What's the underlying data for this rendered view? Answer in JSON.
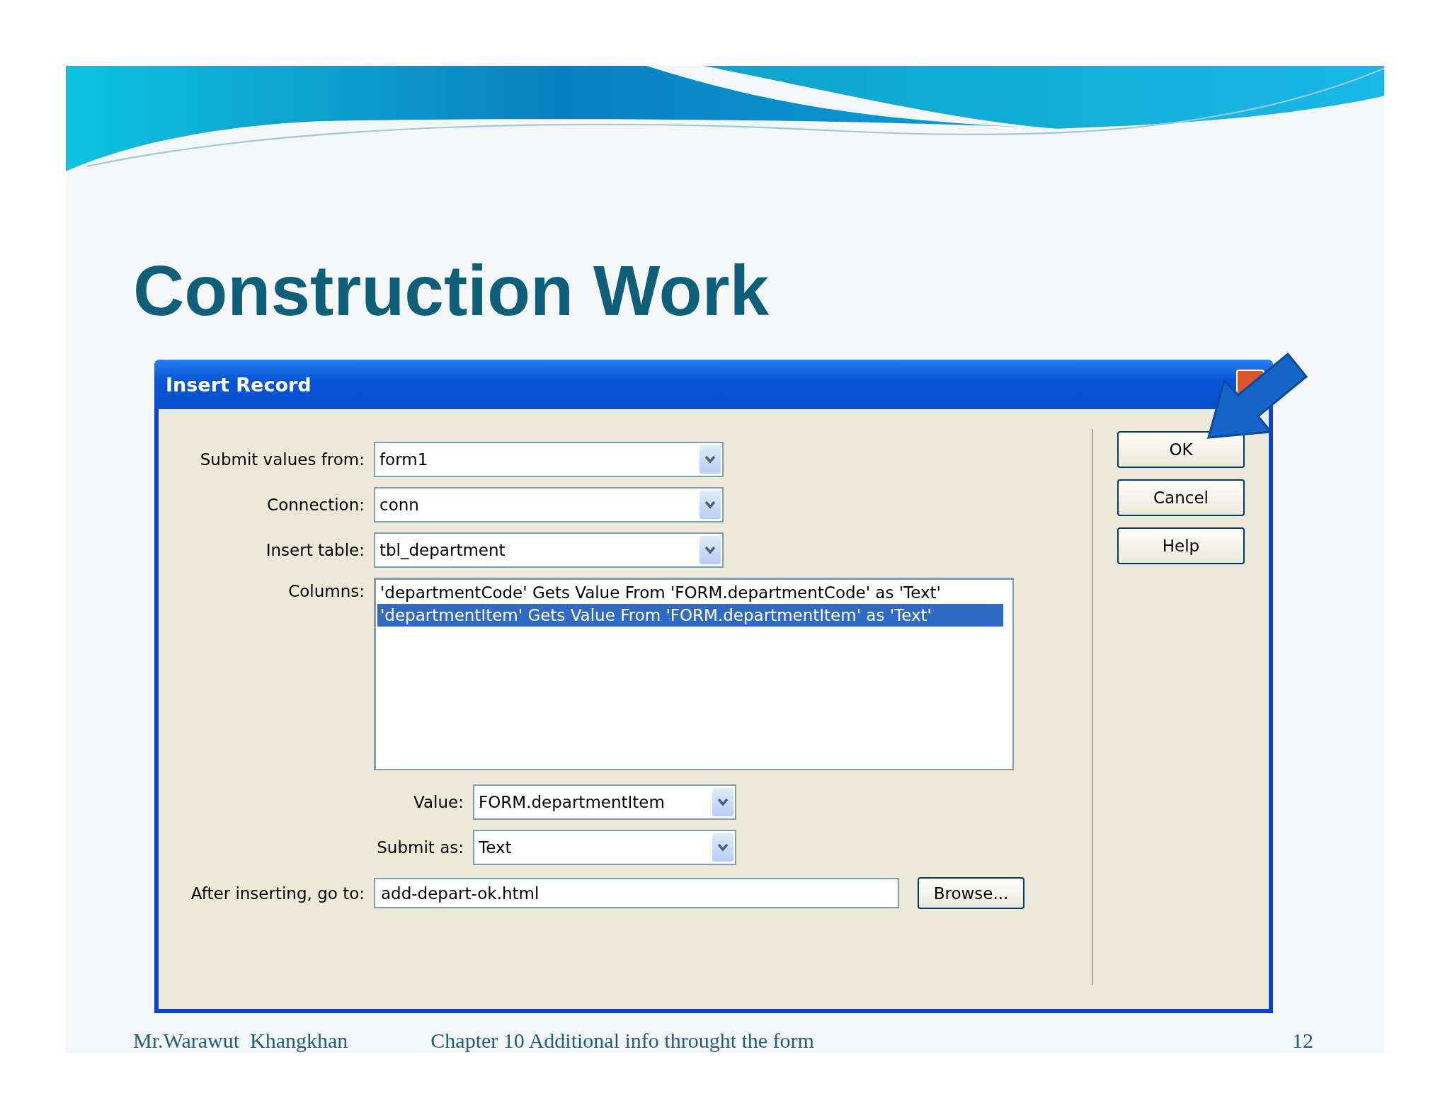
{
  "slide": {
    "title": "Construction Work",
    "footer": {
      "author": "Mr.Warawut  Khangkhan",
      "chapter": "Chapter 10 Additional info throught the form",
      "page": "12"
    }
  },
  "dialog": {
    "title": "Insert Record",
    "fields": [
      {
        "label": "Submit values from:",
        "value": "form1"
      },
      {
        "label": "Connection:",
        "value": "conn"
      },
      {
        "label": "Insert table:",
        "value": "tbl_department"
      }
    ],
    "columns": {
      "label": "Columns:",
      "items": [
        {
          "text": "'departmentCode' Gets Value From 'FORM.departmentCode' as 'Text'",
          "selected": false
        },
        {
          "text": "'departmentItem' Gets Value From 'FORM.departmentItem' as 'Text'",
          "selected": true
        }
      ]
    },
    "value_fields": [
      {
        "label": "Value:",
        "value": "FORM.departmentItem"
      },
      {
        "label": "Submit as:",
        "value": "Text"
      }
    ],
    "after": {
      "label": "After inserting, go to:",
      "value": "add-depart-ok.html",
      "button": "Browse..."
    },
    "buttons": [
      "OK",
      "Cancel",
      "Help"
    ]
  }
}
